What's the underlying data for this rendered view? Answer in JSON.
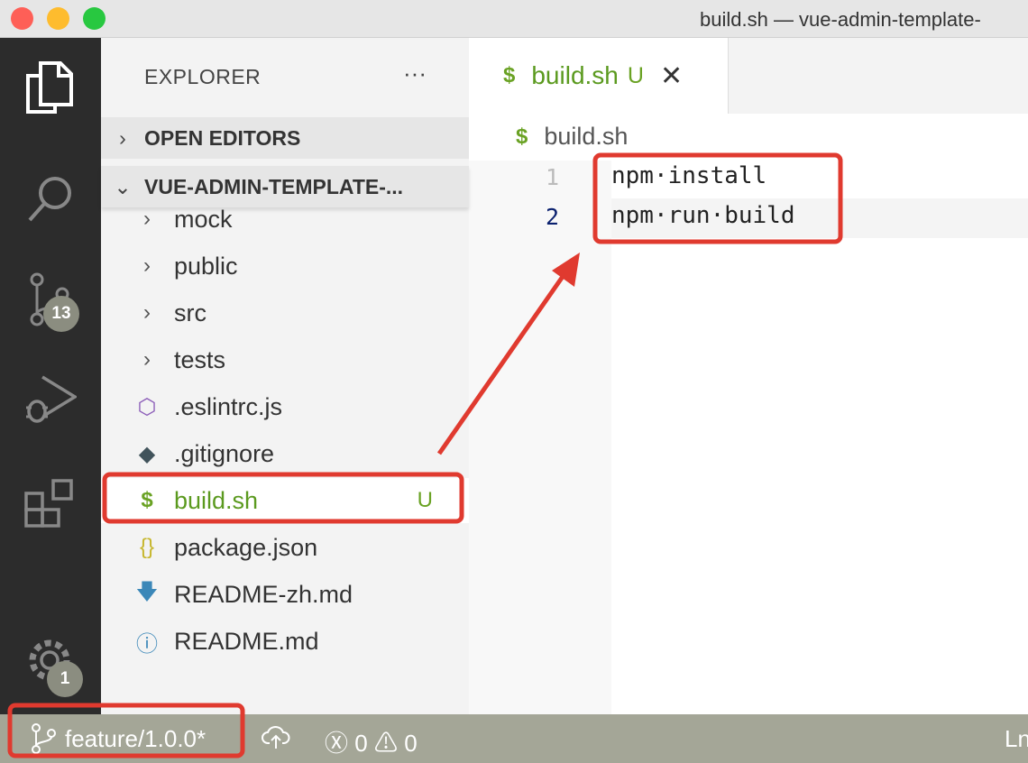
{
  "window": {
    "title": "build.sh — vue-admin-template-"
  },
  "activity_bar": {
    "scm_badge": "13",
    "settings_badge": "1"
  },
  "sidebar": {
    "title": "EXPLORER",
    "more": "···",
    "open_editors": "OPEN EDITORS",
    "folder": "VUE-ADMIN-TEMPLATE-...",
    "items": [
      {
        "label": "mock",
        "icon": "chevron-right",
        "status": ""
      },
      {
        "label": "public",
        "icon": "chevron-right",
        "status": ""
      },
      {
        "label": "src",
        "icon": "chevron-right",
        "status": ""
      },
      {
        "label": "tests",
        "icon": "chevron-right",
        "status": ""
      },
      {
        "label": ".eslintrc.js",
        "icon": "eslint",
        "status": ""
      },
      {
        "label": ".gitignore",
        "icon": "git",
        "status": ""
      },
      {
        "label": "build.sh",
        "icon": "shell-dollar",
        "status": "U"
      },
      {
        "label": "package.json",
        "icon": "braces",
        "status": ""
      },
      {
        "label": "README-zh.md",
        "icon": "download-arrow",
        "status": ""
      },
      {
        "label": "README.md",
        "icon": "info",
        "status": ""
      }
    ]
  },
  "editor": {
    "tab": {
      "label": "build.sh",
      "status": "U",
      "icon": "$"
    },
    "breadcrumb": {
      "icon": "$",
      "label": "build.sh"
    },
    "lines": [
      {
        "n": "1",
        "text": "npm·install"
      },
      {
        "n": "2",
        "text": "npm·run·build"
      }
    ]
  },
  "statusbar": {
    "branch": "feature/1.0.0*",
    "errors": "0",
    "warnings": "0",
    "position": "Ln"
  },
  "colors": {
    "accent_green": "#5b9a1f",
    "annotation_red": "#e03a2f",
    "statusbar": "#a4a697"
  }
}
